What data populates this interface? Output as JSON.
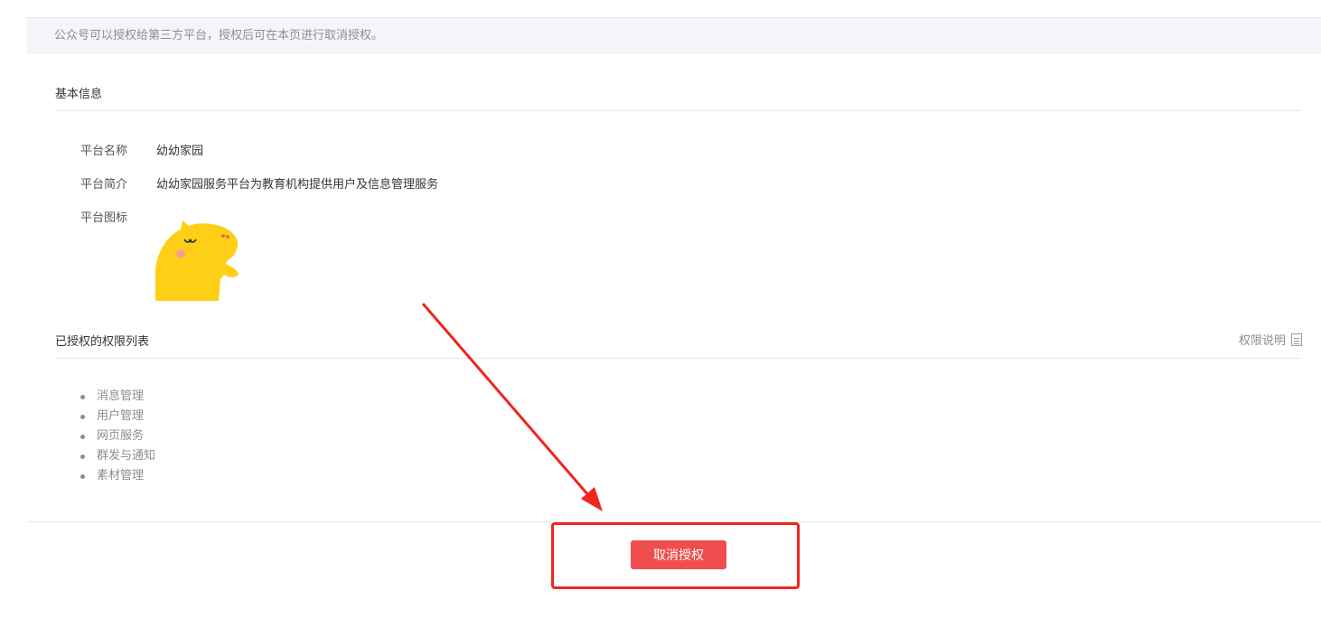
{
  "notice": {
    "text": "公众号可以授权给第三方平台，授权后可在本页进行取消授权。"
  },
  "basic_info": {
    "title": "基本信息",
    "name_label": "平台名称",
    "name_value": "幼幼家园",
    "intro_label": "平台简介",
    "intro_value": "幼幼家园服务平台为教育机构提供用户及信息管理服务",
    "icon_label": "平台图标"
  },
  "permissions": {
    "title": "已授权的权限列表",
    "help_label": "权限说明",
    "items": [
      "消息管理",
      "用户管理",
      "网页服务",
      "群发与通知",
      "素材管理"
    ]
  },
  "footer": {
    "cancel_label": "取消授权"
  },
  "annotation": {
    "color": "#f0251e"
  },
  "colors": {
    "button": "#f04e4e",
    "notice_bg": "#f4f5f9"
  },
  "icons": {
    "platform_logo": "yellow-hippo-logo",
    "help": "document-icon"
  }
}
